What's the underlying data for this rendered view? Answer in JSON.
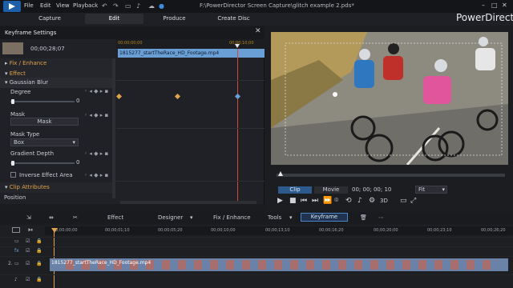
{
  "window": {
    "title": "F:\\PowerDirector Screen Capture\\glitch example 2.pds*",
    "brand": "PowerDirector",
    "menu": [
      "File",
      "Edit",
      "View",
      "Playback"
    ]
  },
  "modes": [
    "Capture",
    "Edit",
    "Produce",
    "Create Disc"
  ],
  "active_mode": "Edit",
  "keyframe_panel": {
    "title": "Keyframe Settings",
    "timecode": "00;00;28;07",
    "ruler_ticks": [
      "00;00;00;00",
      "00;00;10;00"
    ],
    "clip_name": "1815277_startTheRace_HD_Footage.mp4",
    "sections": [
      {
        "name": "Fix / Enhance",
        "expanded": false
      },
      {
        "name": "Effect",
        "expanded": true
      }
    ],
    "effect_name": "Gaussian Blur",
    "params": {
      "degree_label": "Degree",
      "degree_value": "0",
      "mask_label": "Mask",
      "mask_button": "Mask",
      "mask_type_label": "Mask Type",
      "mask_type_value": "Box",
      "gradient_label": "Gradient Depth",
      "gradient_value": "0",
      "inverse_label": "Inverse Effect Area"
    },
    "clip_attributes": "Clip Attributes",
    "position_label": "Position"
  },
  "preview": {
    "tabs": [
      "Clip",
      "Movie"
    ],
    "active_tab": "Clip",
    "timecode": "00; 00; 00; 10",
    "fit": "Fit",
    "mode_3d": "3D"
  },
  "toolbar": {
    "effect": "Effect",
    "designer": "Designer",
    "fix_enhance": "Fix / Enhance",
    "tools": "Tools",
    "keyframe": "Keyframe"
  },
  "timeline": {
    "ruler": [
      "00;00;00;00",
      "00;00;01;10",
      "00;00;05;20",
      "00;00;10;00",
      "00;00;13;10",
      "00;00;16;20",
      "00;00;20;00",
      "00;00;23;10",
      "00;00;26;20"
    ],
    "track2_label": "2.",
    "clip_label": "1815277_startTheRace_HD_Footage.mp4"
  },
  "colors": {
    "accent": "#6a9fd6",
    "section": "#e0a24a",
    "keyline": "#d24a3a"
  }
}
